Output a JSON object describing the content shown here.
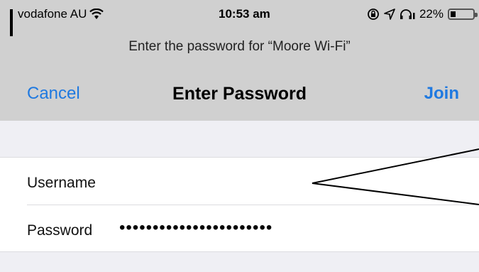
{
  "status_bar": {
    "carrier": "vodafone AU",
    "time": "10:53 am",
    "battery": "22%",
    "battery_level": 0.22,
    "icons": [
      "signal-icon",
      "wifi-icon",
      "lock-rotation-icon",
      "location-icon",
      "headphones-icon"
    ]
  },
  "prompt": "Enter the password for “Moore Wi-Fi”",
  "nav": {
    "cancel": "Cancel",
    "title": "Enter Password",
    "join": "Join"
  },
  "form": {
    "username_label": "Username",
    "password_label": "Password",
    "password_mask": "•••••••••••••••••••••••"
  },
  "colors": {
    "accent": "#1f79e0",
    "header_bg": "#d0d0d0",
    "page_bg": "#efeff4",
    "annotation": "#000000"
  }
}
